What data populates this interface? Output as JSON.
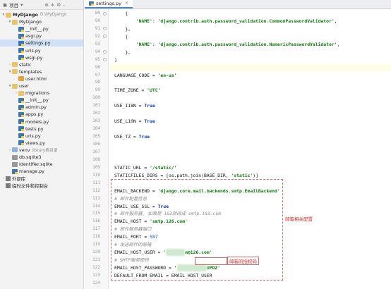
{
  "project_toolbar": {
    "label": "项目",
    "dropdown_icon": "chevron-down-icon"
  },
  "tree": [
    {
      "level": 0,
      "arrow": "▾",
      "icon": "folder",
      "label": "MyDjango",
      "hint": "D:\\MyDjango",
      "bold": true
    },
    {
      "level": 1,
      "arrow": "▾",
      "icon": "folder",
      "label": "MyDjango"
    },
    {
      "level": 2,
      "arrow": "",
      "icon": "py",
      "label": "__init__.py"
    },
    {
      "level": 2,
      "arrow": "",
      "icon": "py",
      "label": "asgi.py"
    },
    {
      "level": 2,
      "arrow": "",
      "icon": "py",
      "label": "settings.py",
      "selected": true
    },
    {
      "level": 2,
      "arrow": "",
      "icon": "py",
      "label": "urls.py"
    },
    {
      "level": 2,
      "arrow": "",
      "icon": "py",
      "label": "wsgi.py"
    },
    {
      "level": 1,
      "arrow": "›",
      "icon": "folder",
      "label": "static"
    },
    {
      "level": 1,
      "arrow": "▾",
      "icon": "folder",
      "label": "templates"
    },
    {
      "level": 2,
      "arrow": "",
      "icon": "html",
      "label": "user.html"
    },
    {
      "level": 1,
      "arrow": "▾",
      "icon": "folder",
      "label": "user"
    },
    {
      "level": 2,
      "arrow": "›",
      "icon": "folder",
      "label": "migrations"
    },
    {
      "level": 2,
      "arrow": "",
      "icon": "py",
      "label": "__init__.py"
    },
    {
      "level": 2,
      "arrow": "",
      "icon": "py",
      "label": "admin.py"
    },
    {
      "level": 2,
      "arrow": "",
      "icon": "py",
      "label": "apps.py"
    },
    {
      "level": 2,
      "arrow": "",
      "icon": "py",
      "label": "models.py"
    },
    {
      "level": 2,
      "arrow": "",
      "icon": "py",
      "label": "tests.py"
    },
    {
      "level": 2,
      "arrow": "",
      "icon": "py",
      "label": "urls.py"
    },
    {
      "level": 2,
      "arrow": "",
      "icon": "py",
      "label": "views.py"
    },
    {
      "level": 1,
      "arrow": "›",
      "icon": "folder-blue",
      "label": "venv",
      "hint": "library根目录"
    },
    {
      "level": 1,
      "arrow": "",
      "icon": "db",
      "label": "db.sqlite3"
    },
    {
      "level": 1,
      "arrow": "",
      "icon": "db",
      "label": "identifier.sqlite"
    },
    {
      "level": 1,
      "arrow": "",
      "icon": "py",
      "label": "manage.py"
    },
    {
      "level": 0,
      "arrow": "›",
      "icon": "lib",
      "label": "外部库"
    },
    {
      "level": 0,
      "arrow": "",
      "icon": "lib",
      "label": "临时文件和控制台"
    }
  ],
  "editor": {
    "tab_label": "settings.py",
    "lines": [
      {
        "n": "89",
        "html": "    {"
      },
      {
        "n": "90",
        "html": "        <span class=\"s\">'NAME'</span>: <span class=\"s\">'django.contrib.auth.password_validation.CommonPasswordValidator'</span>,"
      },
      {
        "n": "91",
        "html": "    },"
      },
      {
        "n": "92",
        "html": "    {"
      },
      {
        "n": "93",
        "html": "        <span class=\"s\">'NAME'</span>: <span class=\"s\">'django.contrib.auth.password_validation.NumericPasswordValidator'</span>,"
      },
      {
        "n": "94",
        "html": "    },"
      },
      {
        "n": "95",
        "html": "]"
      },
      {
        "n": "96",
        "html": "",
        "cur": true
      },
      {
        "n": "97",
        "html": "LANGUAGE_CODE = <span class=\"s\">'en-us'</span>"
      },
      {
        "n": "98",
        "html": ""
      },
      {
        "n": "99",
        "html": "TIME_ZONE = <span class=\"s\">'UTC'</span>"
      },
      {
        "n": "100",
        "html": ""
      },
      {
        "n": "101",
        "html": "USE_I18N = <span class=\"kw\">True</span>"
      },
      {
        "n": "102",
        "html": ""
      },
      {
        "n": "103",
        "html": "USE_L10N = <span class=\"kw\">True</span>"
      },
      {
        "n": "104",
        "html": ""
      },
      {
        "n": "105",
        "html": "USE_TZ = <span class=\"kw\">True</span>"
      },
      {
        "n": "106",
        "html": ""
      },
      {
        "n": "107",
        "html": ""
      },
      {
        "n": "108",
        "html": ""
      },
      {
        "n": "109",
        "html": "STATIC_URL = <span class=\"s\">'/static/'</span>"
      },
      {
        "n": "110",
        "html": "STATICFILES_DIRS = [os.path.join(BASE_DIR, <span class=\"s\">'static'</span>)]"
      },
      {
        "n": "111",
        "html": ""
      },
      {
        "n": "112",
        "html": "EMAIL_BACKEND = <span class=\"s\">'django.core.mail.backends.smtp.EmailBackend'</span>"
      },
      {
        "n": "113",
        "html": "<span class=\"cm\"># 邮件配置信息</span>"
      },
      {
        "n": "114",
        "html": "EMAIL_USE_SSL = <span class=\"kw\">True</span>"
      },
      {
        "n": "115",
        "html": "<span class=\"cm\"># 邮件服务器, 如果是 163就改成 smtp.163.com</span>"
      },
      {
        "n": "116",
        "html": "EMAIL_HOST = <span class=\"s\">'smtp.126.com'</span>"
      },
      {
        "n": "117",
        "html": "<span class=\"cm\"># 邮件服务器端口</span>"
      },
      {
        "n": "118",
        "html": "EMAIL_PORT = <span class=\"num\">587</span>"
      },
      {
        "n": "119",
        "html": "<span class=\"cm\"># 发送邮件的邮箱</span>"
      },
      {
        "n": "120",
        "html": "EMAIL_HOST_USER = <span class=\"s\">'<span class=\"blur\">xxxxxxx</span>m@126.com'</span>"
      },
      {
        "n": "121",
        "html": "<span class=\"cm\"># SMTP服务密码</span>"
      },
      {
        "n": "122",
        "html": "EMAIL_HOST_PASSWORD = <span class=\"s\">'<span class=\"blur\">xxxxxxxxxxx</span>UPDZ'</span>"
      },
      {
        "n": "123",
        "html": "DEFAULT_FROM_EMAIL = EMAIL_HOST_USER"
      },
      {
        "n": "124",
        "html": ""
      }
    ]
  },
  "annotations": {
    "email_config": "邮箱相关配置",
    "auth_code": "邮箱的授权码"
  },
  "colors": {
    "accent": "#4a88c7",
    "annotation": "#e06666",
    "selection": "#cfe0f7"
  }
}
